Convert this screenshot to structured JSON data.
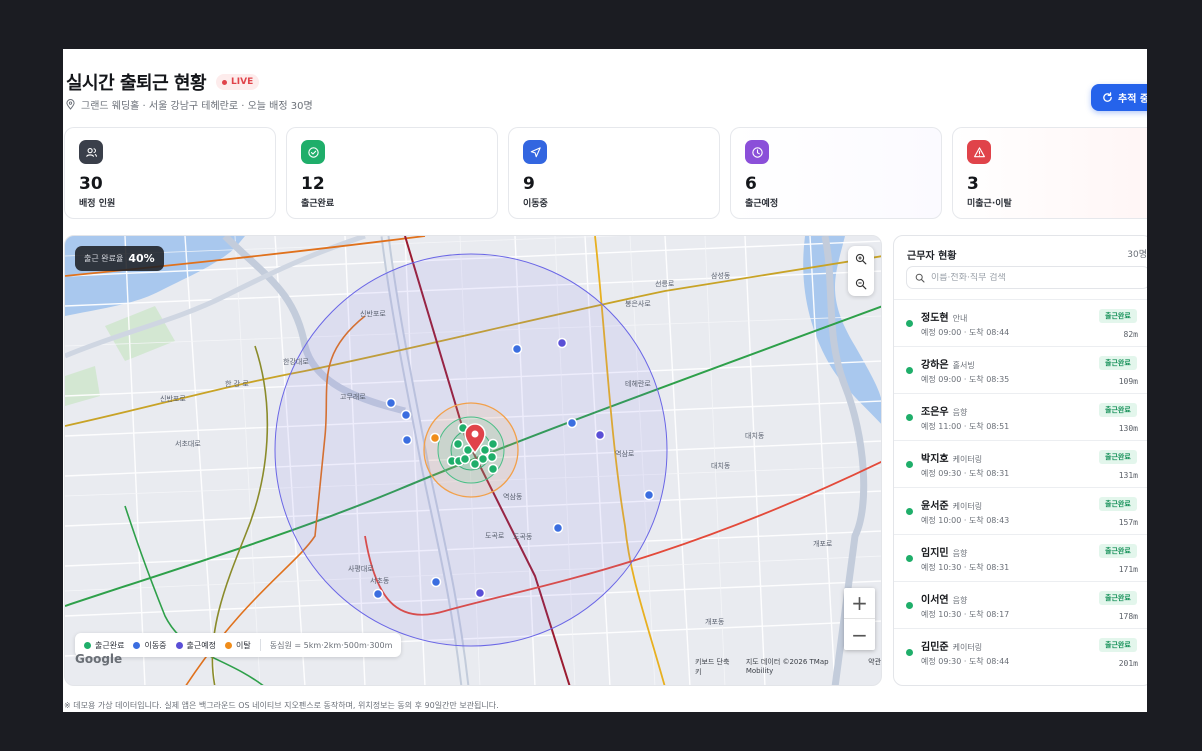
{
  "header": {
    "title": "실시간 출퇴근 현황",
    "live_label": "LIVE",
    "subtitle": "그랜드 웨딩홀 · 서울 강남구 테헤란로 · 오늘 배정 30명",
    "track_button": "추적 중",
    "colors": {
      "accent": "#2563eb",
      "live": "#e0434a"
    }
  },
  "stats": [
    {
      "value": "30",
      "label": "배정 인원",
      "icon": "users-icon",
      "color": "#3a3f4a"
    },
    {
      "value": "12",
      "label": "출근완료",
      "icon": "check-circle-icon",
      "color": "#1fae6a"
    },
    {
      "value": "9",
      "label": "이동중",
      "icon": "navigation-icon",
      "color": "#3366e0"
    },
    {
      "value": "6",
      "label": "출근예정",
      "icon": "clock-icon",
      "color": "#8b4fd9"
    },
    {
      "value": "3",
      "label": "미출근·이탈",
      "icon": "alert-triangle-icon",
      "color": "#e0434a"
    }
  ],
  "map": {
    "completion_label": "출근 완료율",
    "completion_value": "40%",
    "legend": [
      {
        "label": "출근완료",
        "color": "#1fae6a"
      },
      {
        "label": "이동중",
        "color": "#3b6ee0"
      },
      {
        "label": "출근예정",
        "color": "#5a4fd6"
      },
      {
        "label": "이탈",
        "color": "#f08c1a"
      }
    ],
    "legend_note": "동심원 = 5km·2km·500m·300m",
    "google": "Google",
    "attrib_shortcuts": "키보드 단축키",
    "attrib_data": "지도 데이터 ©2026 TMap Mobility",
    "attrib_terms": "약관",
    "zoom_in": "+",
    "zoom_out": "−",
    "place_labels": [
      "고무래로",
      "역삼동",
      "도곡동",
      "서초동",
      "대치동",
      "개포로",
      "선릉로",
      "테헤란로",
      "봉은사로",
      "삼성동",
      "신반포로",
      "한강대로",
      "사평대로",
      "역삼로",
      "개포동",
      "서초대로",
      "도곡로",
      "한 강 로",
      "신반포로",
      "대치동"
    ]
  },
  "panel": {
    "title": "근무자 현황",
    "count": "30명",
    "search_placeholder": "이름·전화·직무 검색",
    "workers": [
      {
        "name": "정도현",
        "role": "안내",
        "time": "예정 09:00 · 도착 08:44",
        "status": "출근완료",
        "distance": "82m"
      },
      {
        "name": "강하은",
        "role": "홀서빙",
        "time": "예정 09:00 · 도착 08:35",
        "status": "출근완료",
        "distance": "109m"
      },
      {
        "name": "조은우",
        "role": "음향",
        "time": "예정 11:00 · 도착 08:51",
        "status": "출근완료",
        "distance": "130m"
      },
      {
        "name": "박지호",
        "role": "케이터링",
        "time": "예정 09:30 · 도착 08:31",
        "status": "출근완료",
        "distance": "131m"
      },
      {
        "name": "윤서준",
        "role": "케이터링",
        "time": "예정 10:00 · 도착 08:43",
        "status": "출근완료",
        "distance": "157m"
      },
      {
        "name": "임지민",
        "role": "음향",
        "time": "예정 10:30 · 도착 08:31",
        "status": "출근완료",
        "distance": "171m"
      },
      {
        "name": "이서연",
        "role": "음향",
        "time": "예정 10:30 · 도착 08:17",
        "status": "출근완료",
        "distance": "178m"
      },
      {
        "name": "김민준",
        "role": "케이터링",
        "time": "예정 09:30 · 도착 08:44",
        "status": "출근완료",
        "distance": "201m"
      }
    ]
  },
  "footnote": "※ 데모용 가상 데이터입니다. 실제 앱은 백그라운드 OS 네이티브 지오펜스로 동작하며, 위치정보는 동의 후 90일간만 보관됩니다."
}
